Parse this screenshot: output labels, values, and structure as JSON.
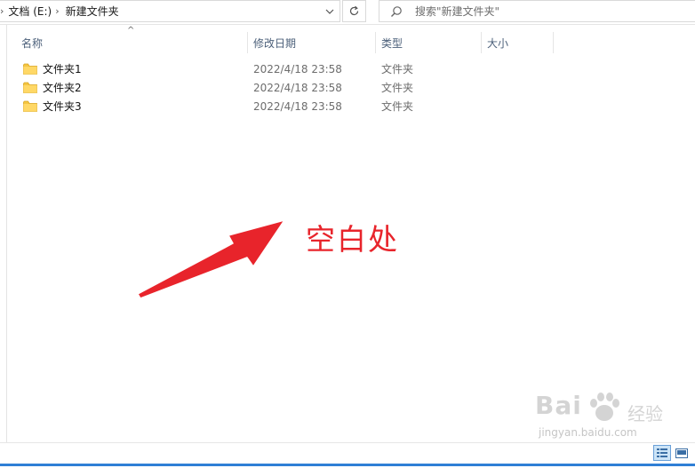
{
  "address_bar": {
    "crumbs": [
      "文档 (E:)",
      "新建文件夹"
    ]
  },
  "search": {
    "placeholder": "搜索\"新建文件夹\""
  },
  "columns": {
    "name": "名称",
    "date": "修改日期",
    "type": "类型",
    "size": "大小"
  },
  "files": [
    {
      "name": "文件夹1",
      "date": "2022/4/18 23:58",
      "type": "文件夹"
    },
    {
      "name": "文件夹2",
      "date": "2022/4/18 23:58",
      "type": "文件夹"
    },
    {
      "name": "文件夹3",
      "date": "2022/4/18 23:58",
      "type": "文件夹"
    }
  ],
  "annotation": {
    "text": "空白处",
    "color": "#e8242b"
  },
  "watermark": {
    "brand": "Bai",
    "brand_suffix": "经验",
    "url": "jingyan.baidu.com"
  },
  "colors": {
    "accent": "#2f7fd6",
    "header_text": "#4c607a",
    "folder": "#f4c542"
  },
  "icons": [
    "chevron-right-icon",
    "chevron-down-icon",
    "refresh-icon",
    "search-icon",
    "folder-icon",
    "sort-up-icon",
    "details-view-icon",
    "tiles-view-icon"
  ]
}
